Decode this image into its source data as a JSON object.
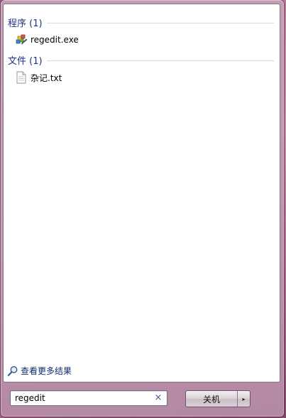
{
  "groups": {
    "programs": {
      "title": "程序 (1)",
      "items": [
        {
          "label": "regedit.exe",
          "icon": "registry-editor-icon"
        }
      ]
    },
    "files": {
      "title": "文件 (1)",
      "items": [
        {
          "label": "杂记.txt",
          "icon": "text-file-icon"
        }
      ]
    }
  },
  "see_more": {
    "label": "查看更多结果",
    "icon": "search-icon"
  },
  "search": {
    "value": "regedit",
    "clear_icon": "×"
  },
  "shutdown": {
    "label": "关机",
    "arrow": "▸"
  },
  "colors": {
    "group_title": "#1e3287",
    "accent_frame": "#b98ca6"
  }
}
